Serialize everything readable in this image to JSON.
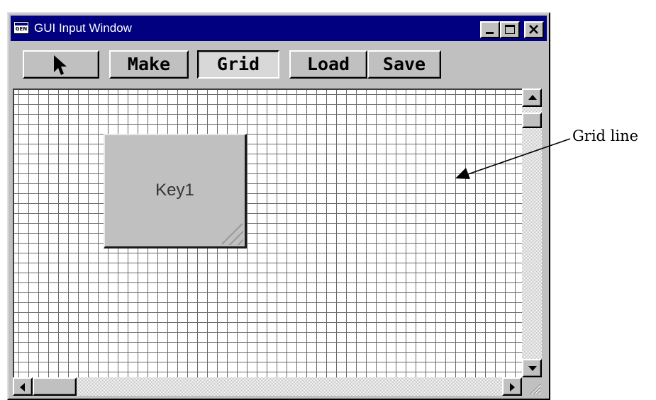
{
  "window": {
    "title": "GUI Input Window",
    "app_icon_text": "GEN"
  },
  "toolbar": {
    "pointer_icon": "arrow-pointer-icon",
    "make_label": "Make",
    "grid_label": "Grid",
    "grid_pressed": true,
    "load_label": "Load",
    "save_label": "Save"
  },
  "canvas": {
    "key_label": "Key1"
  },
  "annotation": {
    "label": "Grid line"
  }
}
